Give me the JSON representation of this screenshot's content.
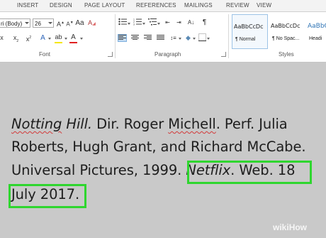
{
  "tabs": [
    "INSERT",
    "DESIGN",
    "PAGE LAYOUT",
    "REFERENCES",
    "MAILINGS",
    "REVIEW",
    "VIEW"
  ],
  "font": {
    "family_value": "ri (Body)",
    "size_value": "26",
    "group_label": "Font"
  },
  "paragraph": {
    "group_label": "Paragraph"
  },
  "styles": {
    "group_label": "Styles",
    "items": [
      {
        "sample": "AaBbCcDc",
        "name": "¶ Normal"
      },
      {
        "sample": "AaBbCcDc",
        "name": "¶ No Spac..."
      },
      {
        "sample": "AaBbCc",
        "name": "Headi"
      }
    ]
  },
  "document": {
    "line1": {
      "title_a": "Notting",
      "title_b": "Hill.",
      "rest_a": " Dir. Roger ",
      "name_err": "Michell",
      "rest_b": ". Perf. Julia"
    },
    "line2": "Roberts, Hugh Grant, and Richard McCabe.",
    "line3": {
      "text": "Universal Pictures, 1999. ",
      "platform": "Netflix",
      "after": ". Web. 18"
    },
    "line4": "July 2017."
  },
  "watermark": {
    "wiki": "wiki",
    "how": "How"
  },
  "colors": {
    "highlight_border": "#2fd62f",
    "spellcheck_underline": "#d23a3a",
    "highlight_fill": "#f5e600",
    "font_color_bar": "#e02020"
  }
}
